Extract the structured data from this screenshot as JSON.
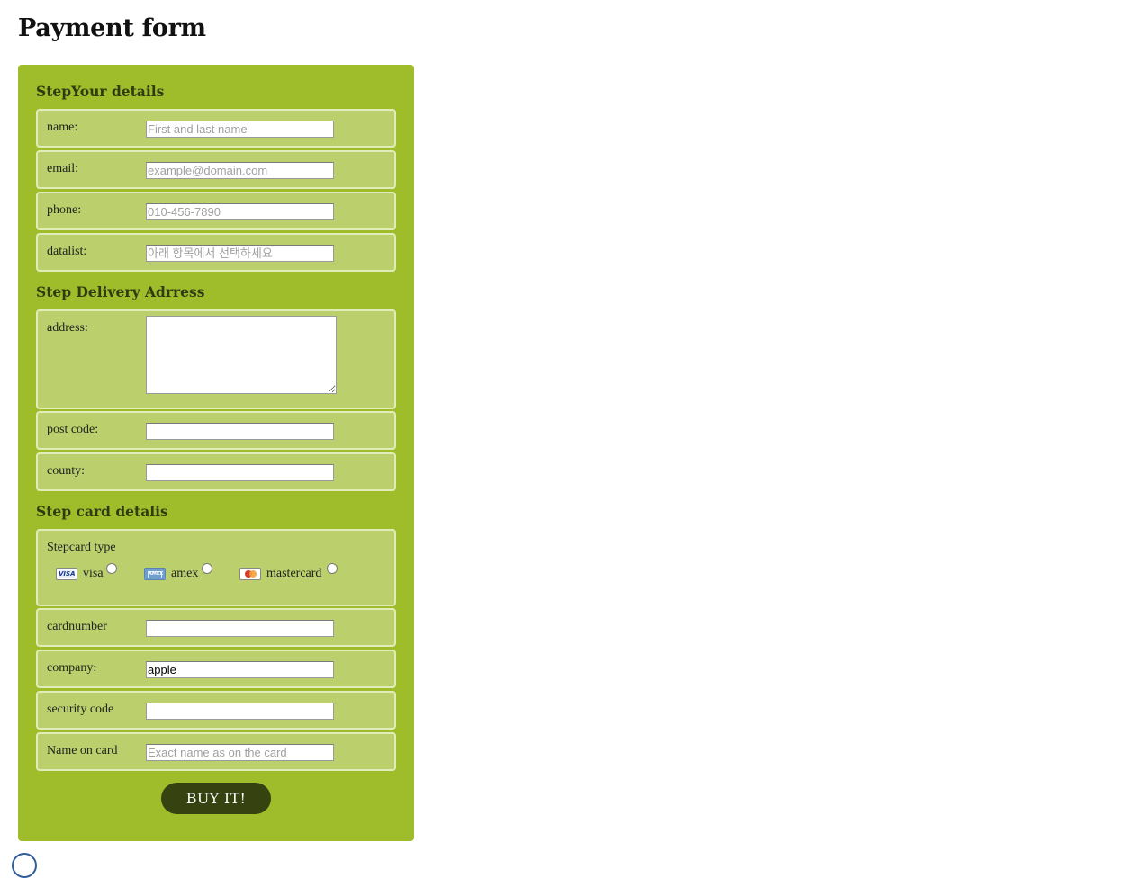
{
  "page": {
    "title": "Payment form"
  },
  "sections": {
    "your_details": "StepYour details",
    "delivery": "Step Delivery Adrress",
    "card": "Step card detalis"
  },
  "fields": {
    "name": {
      "label": "name:",
      "placeholder": "First and last name",
      "value": ""
    },
    "email": {
      "label": "email:",
      "placeholder": "example@domain.com",
      "value": ""
    },
    "phone": {
      "label": "phone:",
      "placeholder": "010-456-7890",
      "value": ""
    },
    "datalist": {
      "label": "datalist:",
      "placeholder": "아래 항목에서 선택하세요",
      "value": ""
    },
    "address": {
      "label": "address:",
      "value": ""
    },
    "post_code": {
      "label": "post code:",
      "value": ""
    },
    "county": {
      "label": "county:",
      "value": ""
    },
    "cardnumber": {
      "label": "cardnumber",
      "value": ""
    },
    "company": {
      "label": "company:",
      "value": "apple"
    },
    "security_code": {
      "label": "security code",
      "value": ""
    },
    "name_on_card": {
      "label": "Name on card",
      "placeholder": "Exact name as on the card",
      "value": ""
    }
  },
  "card_type": {
    "title": "Stepcard type",
    "options": [
      {
        "name": "visa",
        "icon": "visa-card-icon",
        "logo_text": "VISA",
        "selected": false
      },
      {
        "name": "amex",
        "icon": "amex-card-icon",
        "logo_text": "AMEX",
        "selected": false
      },
      {
        "name": "mastercard",
        "icon": "mastercard-icon",
        "selected": false
      }
    ]
  },
  "buy_button": {
    "label": "BUY IT!"
  },
  "colors": {
    "panel": "#9fbd2a",
    "row": "#bbd06c",
    "row_border": "#e1ecb8",
    "button": "#36420f"
  }
}
